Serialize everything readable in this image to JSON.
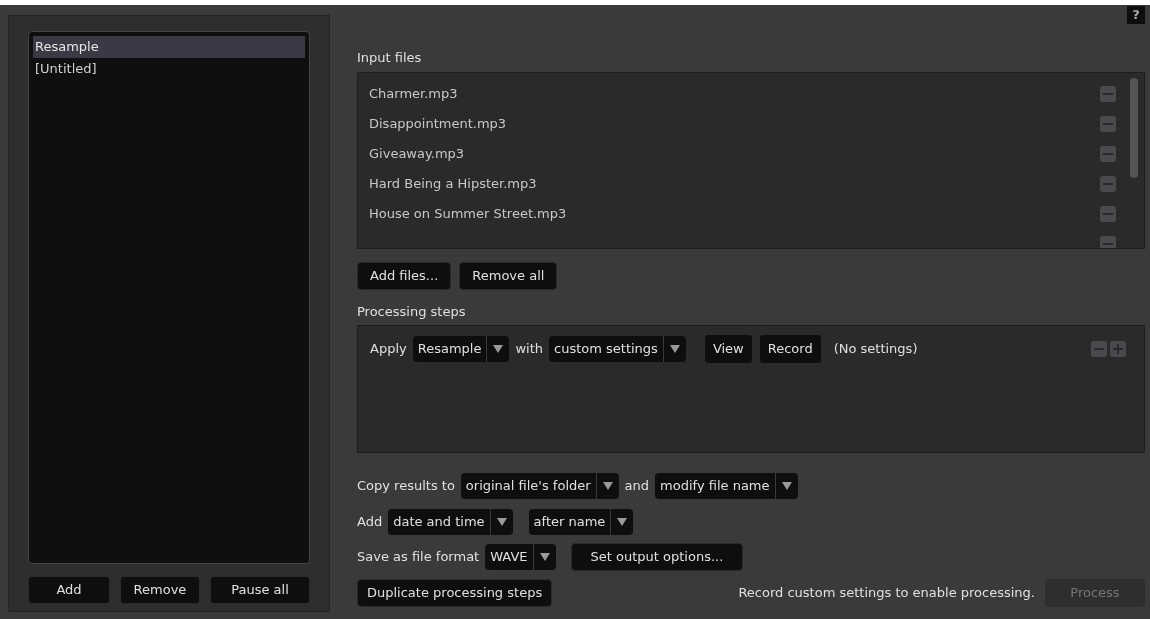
{
  "presets": {
    "items": [
      {
        "label": "Resample",
        "selected": true
      },
      {
        "label": "[Untitled]",
        "selected": false
      }
    ],
    "buttons": [
      "Add",
      "Remove",
      "Pause all"
    ]
  },
  "help_button": "?",
  "input_files": {
    "label": "Input files",
    "files": [
      "Charmer.mp3",
      "Disappointment.mp3",
      "Giveaway.mp3",
      "Hard Being a Hipster.mp3",
      "House on Summer Street.mp3"
    ],
    "buttons": [
      "Add files...",
      "Remove all"
    ]
  },
  "processing_steps": {
    "label": "Processing steps",
    "steps": [
      {
        "prefix": "Apply",
        "effect": "Resample",
        "joiner": "with",
        "settings": "custom settings",
        "buttons": [
          "View",
          "Record"
        ],
        "note": "(No settings)"
      }
    ]
  },
  "copy_row": {
    "label": "Copy results to",
    "destination": "original file's folder",
    "joiner": "and",
    "naming": "modify file name"
  },
  "add_row": {
    "label": "Add",
    "what": "date and time",
    "where": "after name"
  },
  "format_row": {
    "label": "Save as file format",
    "format": "WAVE",
    "button": "Set output options..."
  },
  "footer": {
    "duplicate_button": "Duplicate processing steps",
    "message": "Record custom settings to enable processing.",
    "process_button": {
      "label": "Process",
      "disabled": true
    }
  }
}
